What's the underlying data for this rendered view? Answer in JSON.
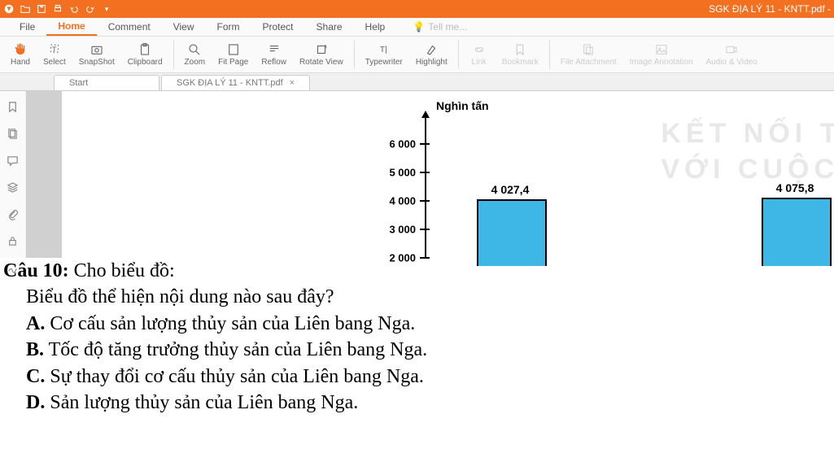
{
  "window": {
    "title": "SGK ĐỊA LÝ 11 - KNTT.pdf -"
  },
  "menu": {
    "file": "File",
    "home": "Home",
    "comment": "Comment",
    "view": "View",
    "form": "Form",
    "protect": "Protect",
    "share": "Share",
    "help": "Help",
    "tellme": "Tell me..."
  },
  "ribbon": {
    "hand": "Hand",
    "select": "Select",
    "snapshot": "SnapShot",
    "clipboard": "Clipboard",
    "zoom": "Zoom",
    "fitpage": "Fit Page",
    "reflow": "Reflow",
    "rotate": "Rotate View",
    "typewriter": "Typewriter",
    "highlight": "Highlight",
    "link": "Link",
    "bookmark": "Bookmark",
    "fileattach": "File Attachment",
    "imageannot": "Image Annotation",
    "audiovideo": "Audio & Video"
  },
  "tabs": {
    "start": "Start",
    "doc": "SGK ĐỊA LÝ 11 - KNTT.pdf",
    "close": "×"
  },
  "chart_data": {
    "type": "bar",
    "ylabel": "Nghìn tấn",
    "yticks": [
      2000,
      3000,
      4000,
      5000,
      6000
    ],
    "ytick_labels": [
      "2 000",
      "3 000",
      "4 000",
      "5 000",
      "6 000"
    ],
    "bars": [
      {
        "label": "4 027,4",
        "value": 4027.4
      },
      {
        "label": "4 075,8",
        "value": 4075.8
      }
    ]
  },
  "watermark": {
    "line1": "KẾT NỐI TR",
    "line2": "VỚI CUỘC"
  },
  "question": {
    "num": "Câu 10:",
    "prompt_rest": " Cho biểu đồ:",
    "sub": "Biểu đồ thể hiện nội dung nào sau đây?",
    "a_label": "A.",
    "a_text": " Cơ cấu sản lượng thủy sản của Liên bang Nga.",
    "b_label": "B.",
    "b_text": " Tốc độ tăng trưởng thủy sản của Liên bang Nga.",
    "c_label": "C.",
    "c_text": " Sự thay đổi cơ cấu thủy sản của Liên bang Nga.",
    "d_label": "D.",
    "d_text": " Sản lượng thủy sản của Liên bang Nga."
  }
}
